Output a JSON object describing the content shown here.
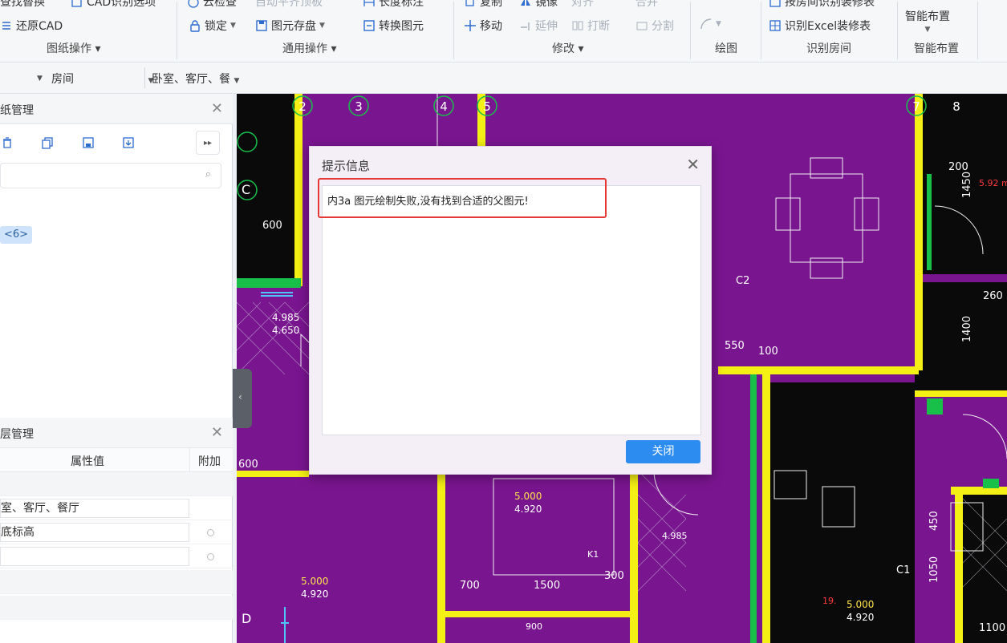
{
  "ribbon": {
    "row1": {
      "find_replace": "查找替换",
      "cad_options": "CAD识别选项",
      "cloud_check": "云检查",
      "auto_level": "自动平齐顶板",
      "length_dim": "长度标注",
      "copy": "复制",
      "mirror": "镜像",
      "align": "对齐",
      "merge": "合并",
      "by_room": "按房间识别装修表"
    },
    "row2": {
      "restore_cad": "还原CAD",
      "lock": "锁定",
      "save_element": "图元存盘",
      "convert_element": "转换图元",
      "move": "移动",
      "extend": "延伸",
      "break": "打断",
      "split": "分割",
      "excel_deco": "识别Excel装修表",
      "smart_layout_btn": "智能布置"
    },
    "groups": {
      "drawing_ops": "图纸操作",
      "common_ops": "通用操作",
      "modify": "修改",
      "draw": "绘图",
      "recognize_room": "识别房间",
      "smart_layout": "智能布置"
    }
  },
  "filterbar": {
    "dd2": "房间",
    "dd3": "卧室、客厅、餐"
  },
  "left_panel": {
    "drawing_mgmt_title": "纸管理",
    "chip": "<6>",
    "layer_title": "层管理",
    "col_value": "属性值",
    "col_extra": "附加",
    "rows": [
      "室、客厅、餐厅",
      "底标高",
      ""
    ]
  },
  "dialog": {
    "title": "提示信息",
    "message": "内3a 图元绘制失败,没有找到合适的父图元!",
    "close_button": "关闭"
  },
  "cad_text": {
    "axis_labels": [
      "2",
      "3",
      "4",
      "5",
      "7",
      "8"
    ],
    "label_c": "C",
    "label_d": "D",
    "dim_550": "550",
    "dim_100": "100",
    "dim_600": "600",
    "elev_a": "4.985",
    "elev_b": "4.650",
    "elev_c": "5.000",
    "elev_d": "4.920",
    "dim_700": "700",
    "dim_1500": "1500",
    "dim_300": "300",
    "dim_1050": "1050",
    "dim_450": "450",
    "dim_1400": "1400",
    "dim_1450": "1450",
    "dim_200": "200",
    "dim_1100": "1100",
    "dim_260": "260",
    "label_c2": "C2",
    "label_c1": "C1",
    "label_k1": "K1",
    "dim_900": "900"
  },
  "colors": {
    "cad_background": "#7a1590",
    "cad_wall_yellow": "#f4ef14",
    "cad_green": "#18c04a",
    "dialog_button": "#2d8cf0",
    "highlight_red": "#e53935"
  }
}
